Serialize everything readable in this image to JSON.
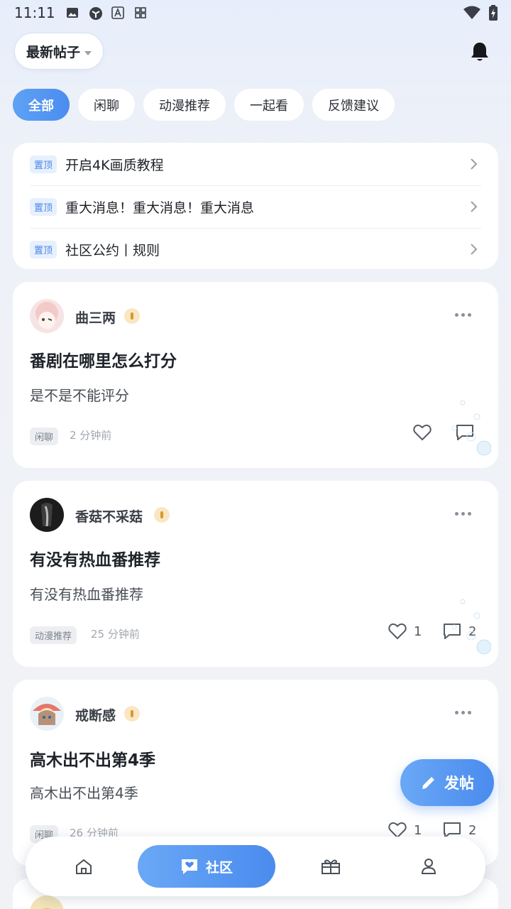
{
  "status_bar": {
    "time": "11:11"
  },
  "header": {
    "sort_label": "最新帖子"
  },
  "tabs": [
    {
      "label": "全部",
      "active": true
    },
    {
      "label": "闲聊"
    },
    {
      "label": "动漫推荐"
    },
    {
      "label": "一起看"
    },
    {
      "label": "反馈建议"
    }
  ],
  "pinned": {
    "tag": "置顶",
    "items": [
      {
        "text": "开启4K画质教程"
      },
      {
        "text": "重大消息！重大消息！重大消息"
      },
      {
        "text": "社区公约丨规则"
      }
    ]
  },
  "posts": [
    {
      "username": "曲三两",
      "title": "番剧在哪里怎么打分",
      "body": "是不是不能评分",
      "category": "闲聊",
      "time": "2 分钟前",
      "likes": "",
      "comments": ""
    },
    {
      "username": "香菇不采菇",
      "title": "有没有热血番推荐",
      "body": "有没有热血番推荐",
      "category": "动漫推荐",
      "time": "25 分钟前",
      "likes": "1",
      "comments": "2"
    },
    {
      "username": "戒断感",
      "title": "高木出不出第4季",
      "body": "高木出不出第4季",
      "category": "闲聊",
      "time": "26 分钟前",
      "likes": "1",
      "comments": "2"
    }
  ],
  "fab": {
    "label": "发帖"
  },
  "bottom_nav": {
    "community_label": "社区"
  },
  "colors": {
    "accent": "#4a8bee",
    "pin_tag": "#4a86e8"
  }
}
